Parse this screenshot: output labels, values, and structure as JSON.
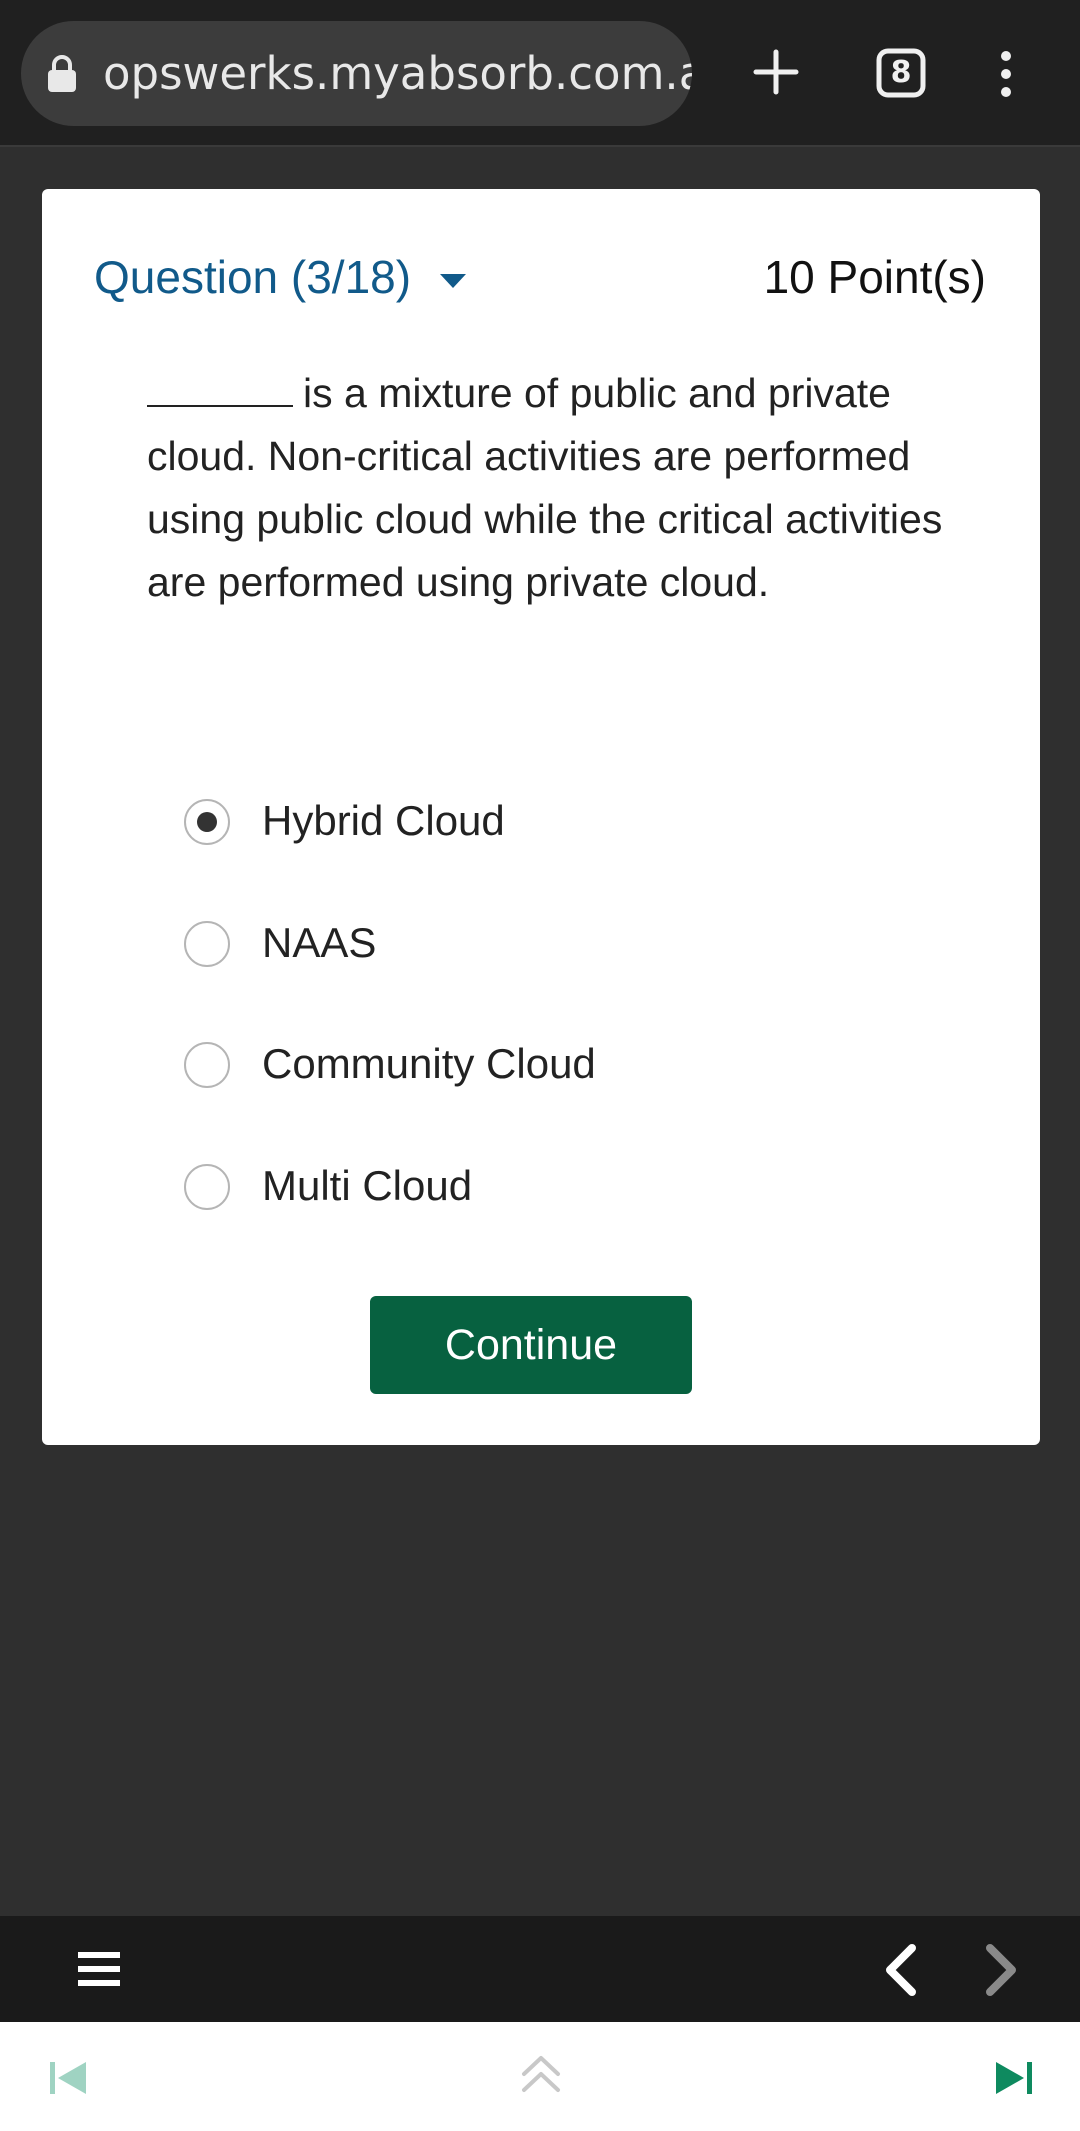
{
  "browser": {
    "url": "opswerks.myabsorb.com.au",
    "tab_count": "8",
    "icons": [
      "lock-icon",
      "plus-icon",
      "tabs-icon",
      "more-vert-icon"
    ]
  },
  "question": {
    "heading": "Question (3/18)",
    "points": "10 Point(s)",
    "prompt_text": "is a mixture of public and private cloud. Non-critical activities are performed using public cloud while the critical activities are performed using private cloud.",
    "options": [
      {
        "label": "Hybrid Cloud",
        "selected": true
      },
      {
        "label": "NAAS",
        "selected": false
      },
      {
        "label": "Community Cloud",
        "selected": false
      },
      {
        "label": "Multi Cloud",
        "selected": false
      }
    ],
    "continue_label": "Continue"
  },
  "colors": {
    "accent_blue": "#115a8a",
    "continue_green": "#076140",
    "nav_teal": "#0e8a5f",
    "nav_teal_disabled": "#9fd3c2"
  }
}
